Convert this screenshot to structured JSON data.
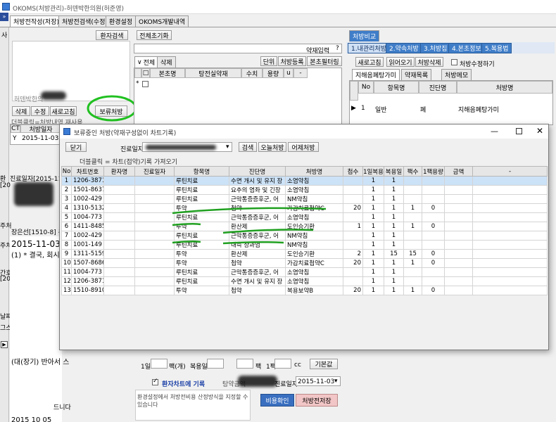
{
  "window": {
    "title": "OKOMS(처방관리)-허덴박한의원(허준영)",
    "icon": "app-icon"
  },
  "main_tabs": [
    "처방전작성(저장)",
    "처방전검색(수정)",
    "환경설정",
    "OKOMS개발내역"
  ],
  "left": {
    "patient_search": "환자검색",
    "clinic_name": "허덴박한의",
    "buttons": [
      "삭제",
      "수정",
      "새로고침",
      "보류처방"
    ],
    "hint": "더블클릭=처방내역 재사용",
    "col_ct": "CT",
    "col_date": "처방일자",
    "row": {
      "ct": "Y",
      "date": "2015-11-03"
    },
    "side_labels": [
      "사",
      "환",
      "[20",
      "주처",
      "주처",
      "간호",
      "[20",
      "날짜",
      "그스",
      "]"
    ],
    "side_texts": [
      "진료일자[2015-11-0",
      "장은선[1510-8] 주치",
      "2015-11-03",
      "(1) * 결국, 회시",
      "(대(장기) 반아서 스",
      "드니다",
      "2015 10 05"
    ]
  },
  "middle": {
    "reset_all": "전체초기화",
    "herb_input": "약재입력",
    "herb_input_arrow": "?",
    "sub_tabs": [
      "전체",
      "삭제"
    ],
    "filter_buttons": [
      "단위",
      "처방등록",
      "본초필터링"
    ],
    "cols": [
      "본초명",
      "탕전실약재",
      "수치",
      "용량",
      "u",
      "-"
    ],
    "bottom": {
      "day_label": "1일",
      "count_label": "팩(개)",
      "dose_label": "복용일",
      "pack_label": "팩",
      "pack1_label": "1팩",
      "cc_label": "cc",
      "default_btn": "기본값",
      "record_label": "환자차트에 기록",
      "price_label": "탕약금액",
      "visit_label": "진료일자",
      "visit_date": "2015-11-03",
      "notice": "환경설정에서 처방전비용 산정방식을 지정할 수 있습니다",
      "confirm_btn": "비용확인",
      "save_btn": "처방전저장"
    }
  },
  "right": {
    "compare_tab": "처방비교",
    "tabs": [
      "1.내관리처방",
      "2.약속처방",
      "3.처방집",
      "4.본초정보",
      "5.복용법"
    ],
    "buttons": [
      "새로고침",
      "읽어오기",
      "처방삭제"
    ],
    "checkbox_label": "처방수정하기",
    "sub_tabs": [
      "지해음폐탕가미",
      "약재목록",
      "처방메모"
    ],
    "cols": [
      "No",
      "항목명",
      "진단명",
      "처방명"
    ],
    "row": {
      "no": "1",
      "item": "일반",
      "diag": "폐",
      "rx": "지해음폐탕가미"
    }
  },
  "dialog": {
    "title": "보류중인 처방(약재구성없이 차트기록)",
    "close_btn": "닫기",
    "visit_label": "진료일자",
    "search_btn": "검색",
    "today_btn": "오늘처방",
    "yesterday_btn": "어제처방",
    "hint": "더블클릭 = 차트(접약)기록 가져오기",
    "cols": [
      "No",
      "차트번호",
      "환자명",
      "진료일자",
      "항목명",
      "진단명",
      "처방명",
      "첩수",
      "1일복용",
      "복용일",
      "팩수",
      "1팩용량",
      "금액",
      "-"
    ],
    "rows": [
      [
        "1",
        "1206-3871",
        "",
        "",
        "루틴치료",
        "수면 개시 및 유지 장",
        "소염약침",
        "",
        "1",
        "1",
        "",
        "",
        ""
      ],
      [
        "2",
        "1501-8637",
        "",
        "",
        "루틴치료",
        "요추의 염좌 및 긴장",
        "소염약침",
        "",
        "1",
        "1",
        "",
        "",
        ""
      ],
      [
        "3",
        "1002-429",
        "",
        "",
        "루틴치료",
        "근막통증증후군, 어",
        "NM약침",
        "",
        "1",
        "1",
        "",
        "",
        ""
      ],
      [
        "4",
        "1310-5132",
        "",
        "",
        "투약",
        "첩약",
        "가감치료첩약C",
        "20",
        "1",
        "1",
        "1",
        "0",
        ""
      ],
      [
        "5",
        "1004-773",
        "",
        "",
        "루틴치료",
        "근막통증증후군, 어",
        "소염약침",
        "",
        "1",
        "1",
        "",
        "",
        ""
      ],
      [
        "6",
        "1411-8485",
        "",
        "",
        "투약",
        "환산제",
        "도인승기환",
        "1",
        "1",
        "1",
        "1",
        "0",
        ""
      ],
      [
        "7",
        "1002-429",
        "",
        "",
        "루틴치료",
        "근막통증증후군, 어",
        "NM약침",
        "",
        "1",
        "1",
        "",
        "",
        ""
      ],
      [
        "8",
        "1001-149",
        "",
        "",
        "루틴치료",
        "내측 상과염",
        "NM약침",
        "",
        "1",
        "1",
        "",
        "",
        ""
      ],
      [
        "9",
        "1311-5159",
        "",
        "",
        "투약",
        "환산제",
        "도인승기환",
        "2",
        "1",
        "15",
        "15",
        "0",
        ""
      ],
      [
        "10",
        "1507-8686",
        "",
        "",
        "투약",
        "첩약",
        "가감치료첩약C",
        "20",
        "1",
        "1",
        "1",
        "0",
        ""
      ],
      [
        "11",
        "1004-773",
        "",
        "",
        "루틴치료",
        "근막통증증후군, 어",
        "소염약침",
        "",
        "1",
        "1",
        "",
        "",
        ""
      ],
      [
        "12",
        "1206-3871",
        "",
        "",
        "루틴치료",
        "수면 개시 및 유지 장",
        "소염약침",
        "",
        "1",
        "1",
        "",
        "",
        ""
      ],
      [
        "13",
        "1510-8910",
        "",
        "",
        "투약",
        "첩약",
        "복용보약B",
        "20",
        "1",
        "1",
        "1",
        "0",
        ""
      ]
    ]
  }
}
